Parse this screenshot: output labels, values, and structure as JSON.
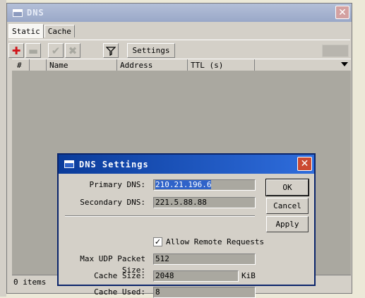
{
  "window": {
    "title": "DNS",
    "tabs": [
      {
        "label": "Static"
      },
      {
        "label": "Cache"
      }
    ],
    "toolbar": {
      "add_symbol": "✚",
      "remove_symbol": "▬",
      "enable_symbol": "✔",
      "disable_symbol": "✖",
      "settings_label": "Settings"
    },
    "columns": [
      "#",
      "Name",
      "Address",
      "TTL (s)"
    ],
    "status": "0 items"
  },
  "dialog": {
    "title": "DNS Settings",
    "primary_dns_label": "Primary DNS:",
    "primary_dns_value": "210.21.196.6",
    "secondary_dns_label": "Secondary DNS:",
    "secondary_dns_value": "221.5.88.88",
    "allow_remote_label": "Allow Remote Requests",
    "allow_remote_checked": true,
    "max_udp_label": "Max UDP Packet Size:",
    "max_udp_value": "512",
    "cache_size_label": "Cache Size:",
    "cache_size_value": "2048",
    "cache_size_unit": "KiB",
    "cache_used_label": "Cache Used:",
    "cache_used_value": "8",
    "buttons": {
      "ok": "OK",
      "cancel": "Cancel",
      "apply": "Apply"
    }
  },
  "colors": {
    "dialog_titlebar": "#0a3b9a",
    "close_button": "#cb4a32",
    "selection": "#2f63c9"
  }
}
